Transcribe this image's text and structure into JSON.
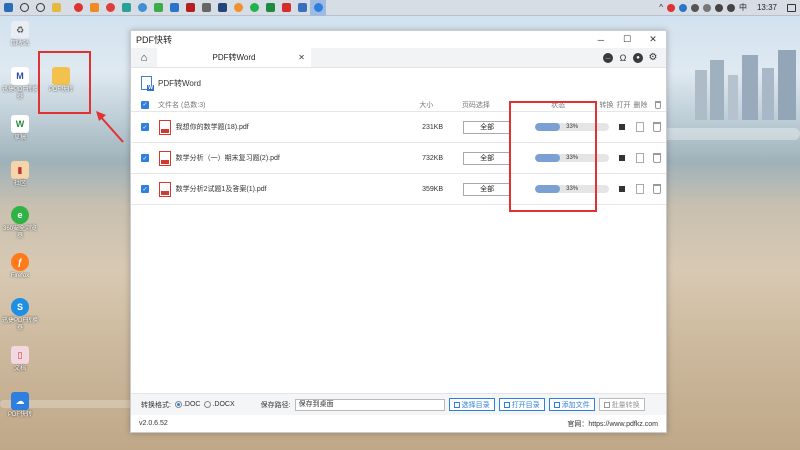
{
  "taskbar": {
    "clock": "13:37",
    "tray_lang": "中"
  },
  "desktop": {
    "icons": [
      {
        "label": "回收站",
        "icon": "recycle-bin-icon"
      },
      {
        "label": "迅捷PDF转换器",
        "icon": "mj-app-icon"
      },
      {
        "label": "PDF快转",
        "icon": "folder-icon"
      },
      {
        "label": "草稿",
        "icon": "word-doc-icon"
      },
      {
        "label": "社区",
        "icon": "book-icon"
      },
      {
        "label": "360安全浏览器",
        "icon": "browser-icon"
      },
      {
        "label": "Firefox",
        "icon": "firefox-icon"
      },
      {
        "label": "迅捷PDF转换器",
        "icon": "s-app-icon"
      },
      {
        "label": "文档",
        "icon": "doc-icon"
      },
      {
        "label": "PDF快转",
        "icon": "cloud-pdf-icon"
      }
    ]
  },
  "window": {
    "title": "PDF快转",
    "tab": "PDF转Word",
    "subheader": "PDF转Word",
    "headers": {
      "name": "文件名 (总数:3)",
      "size": "大小",
      "page": "页码选择",
      "status": "状态",
      "convert": "转换",
      "open": "打开",
      "delete": "删除"
    },
    "files": [
      {
        "name": "我想你的数学题(18).pdf",
        "size": "231KB",
        "page": "全部",
        "progress": 33,
        "progress_text": "33%"
      },
      {
        "name": "数学分析（一）期末复习题(2).pdf",
        "size": "732KB",
        "page": "全部",
        "progress": 33,
        "progress_text": "33%"
      },
      {
        "name": "数学分析2试题1及答案(1).pdf",
        "size": "359KB",
        "page": "全部",
        "progress": 33,
        "progress_text": "33%"
      }
    ],
    "footer": {
      "format_label": "转换格式:",
      "format_doc": ".DOC",
      "format_docx": ".DOCX",
      "path_label": "保存路径:",
      "path_value": "保存到桌面",
      "choose_dir": "选择目录",
      "open_dir": "打开目录",
      "add_file": "添加文件",
      "batch_convert": "批量转换"
    },
    "version": "v2.0.6.52",
    "website": "官网：https://www.pdfkz.com"
  },
  "colors": {
    "accent": "#2f7fe0",
    "progress": "#7ba0d4",
    "highlight": "#e23131"
  }
}
